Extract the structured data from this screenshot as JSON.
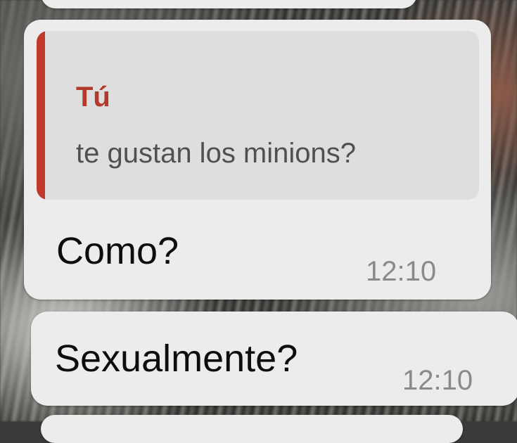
{
  "chat": {
    "reply_message": {
      "quoted": {
        "author": "Tú",
        "text": "te gustan los minions?"
      },
      "text": "Como?",
      "time": "12:10"
    },
    "second_message": {
      "text": "Sexualmente?",
      "time": "12:10"
    }
  },
  "colors": {
    "bubble": "#ececec",
    "quote_background": "#dedede",
    "quote_accent": "#c0392b",
    "quote_author": "#b33a2d",
    "timestamp": "#8a8a8a"
  }
}
